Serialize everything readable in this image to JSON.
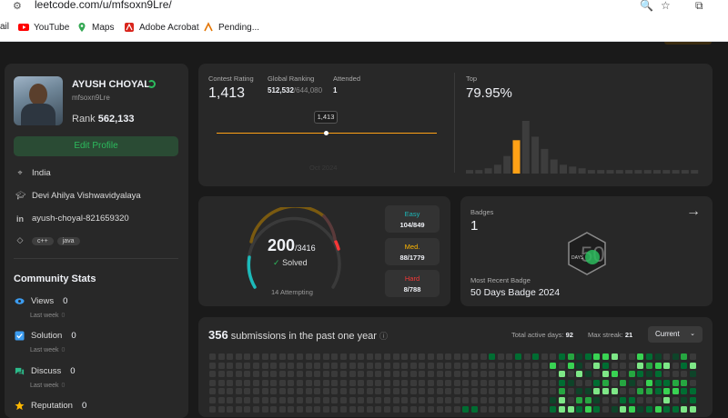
{
  "browser": {
    "url": "leetcode.com/u/mfsoxn9Lre/",
    "bookmarks": [
      {
        "label": "ail",
        "icon": "gmail-icon",
        "color": "#d93025"
      },
      {
        "label": "YouTube",
        "icon": "youtube-icon",
        "color": "#ff0000"
      },
      {
        "label": "Maps",
        "icon": "maps-icon",
        "color": "#34a853"
      },
      {
        "label": "Adobe Acrobat",
        "icon": "acrobat-icon",
        "color": "#d9251c"
      },
      {
        "label": "Pending...",
        "icon": "pending-icon",
        "color": "#e37400"
      }
    ]
  },
  "profile": {
    "name": "AYUSH CHOYAL",
    "username": "mfsoxn9Lre",
    "rank_label": "Rank",
    "rank_value": "562,133",
    "edit_label": "Edit Profile",
    "location": "India",
    "school": "Devi Ahilya Vishwavidyalaya",
    "linkedin": "ayush-choyal-821659320",
    "tags": [
      "c++",
      "java"
    ]
  },
  "community": {
    "title": "Community Stats",
    "items": [
      {
        "label": "Views",
        "value": "0",
        "sub": "Last week",
        "sub_value": "0",
        "icon": "eye-icon",
        "color": "#3c9cf0"
      },
      {
        "label": "Solution",
        "value": "0",
        "sub": "Last week",
        "sub_value": "0",
        "icon": "check-square-icon",
        "color": "#3c9cf0"
      },
      {
        "label": "Discuss",
        "value": "0",
        "sub": "Last week",
        "sub_value": "0",
        "icon": "discuss-icon",
        "color": "#2cbb8a"
      },
      {
        "label": "Reputation",
        "value": "0",
        "sub": "",
        "sub_value": "",
        "icon": "reputation-icon",
        "color": "#ffb800"
      }
    ]
  },
  "contest": {
    "rating_label": "Contest Rating",
    "rating": "1,413",
    "global_label": "Global Ranking",
    "global_value": "512,532",
    "global_total": "/644,080",
    "attended_label": "Attended",
    "attended": "1",
    "tooltip": "1,413",
    "date_label": "Oct 2024",
    "top_label": "Top",
    "top_value": "79.95%",
    "histogram": [
      2,
      2,
      3,
      5,
      10,
      19,
      30,
      21,
      14,
      8,
      5,
      4,
      3,
      2,
      2,
      2,
      2,
      2,
      2,
      2,
      2,
      2,
      2,
      2,
      2
    ],
    "histogram_highlight": 5
  },
  "solved": {
    "count": "200",
    "total": "/3416",
    "solved_label": "Solved",
    "attempting": "14 Attempting",
    "difficulties": [
      {
        "label": "Easy",
        "value": "104/849",
        "color": "#1cbaba"
      },
      {
        "label": "Med.",
        "value": "88/1779",
        "color": "#ffb700"
      },
      {
        "label": "Hard",
        "value": "8/788",
        "color": "#f63737"
      }
    ]
  },
  "badges": {
    "label": "Badges",
    "count": "1",
    "recent_label": "Most Recent Badge",
    "recent_name": "50 Days Badge 2024",
    "badge_text": "DAYS",
    "badge_num": "50"
  },
  "submissions": {
    "count": "356",
    "text": "submissions in the past one year",
    "active_label": "Total active days:",
    "active_value": "92",
    "streak_label": "Max streak:",
    "streak_value": "21",
    "select_value": "Current"
  }
}
